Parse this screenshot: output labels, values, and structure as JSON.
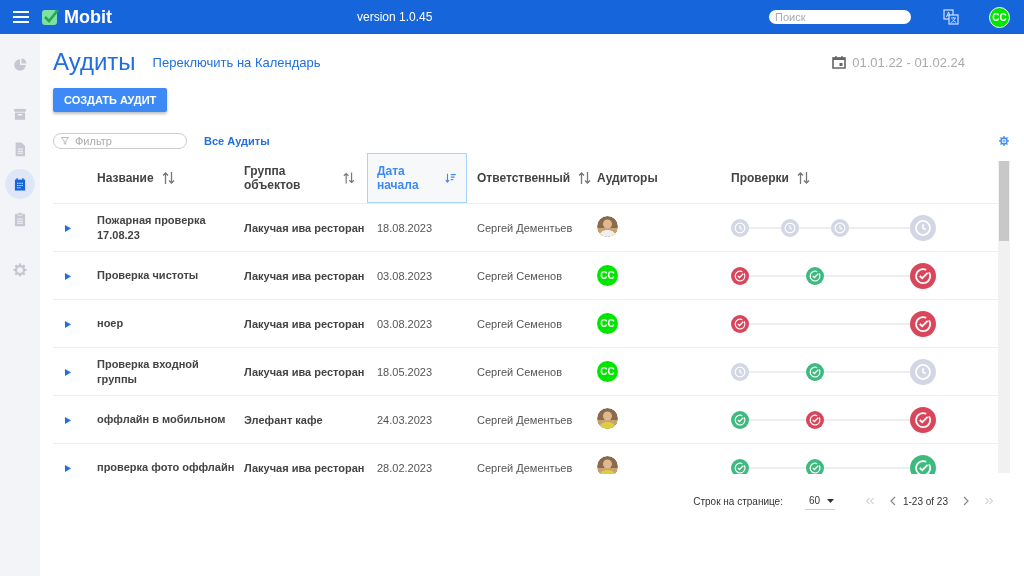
{
  "topbar": {
    "brand": "Mobit",
    "version": "version 1.0.45",
    "search": {
      "placeholder": "Поиск"
    },
    "user_initials": "CC"
  },
  "sidebar": {
    "items": [
      {
        "kind": "chart",
        "selected": false
      },
      {
        "kind": "archive",
        "selected": false
      },
      {
        "kind": "document",
        "selected": false
      },
      {
        "kind": "calendar",
        "selected": true
      },
      {
        "kind": "clipboard",
        "selected": false
      },
      {
        "kind": "settings",
        "selected": false
      }
    ]
  },
  "page": {
    "title": "Аудиты",
    "switch_link": "Переключить на Календарь",
    "date_range": "01.01.22 - 01.02.24",
    "create_button": "СОЗДАТЬ АУДИТ",
    "filter": {
      "placeholder": "Фильтр"
    },
    "all_link": "Все Аудиты"
  },
  "table": {
    "columns": [
      {
        "label": "Название",
        "sortable": true,
        "selected": false
      },
      {
        "label": "Группа объектов",
        "sortable": true,
        "selected": false
      },
      {
        "label": "Дата начала",
        "sortable": true,
        "selected": true
      },
      {
        "label": "Ответственный",
        "sortable": true,
        "selected": false
      },
      {
        "label": "Аудиторы",
        "sortable": false,
        "selected": false
      },
      {
        "label": "Проверки",
        "sortable": true,
        "selected": false
      }
    ],
    "rows": [
      {
        "name": "Пожарная проверка 17.08.23",
        "group": "Лакучая ива ресторан",
        "date": "18.08.2023",
        "owner": "Сергей Дементьев",
        "auditor": {
          "kind": "picture"
        },
        "checks": [
          {
            "kind": "pending"
          },
          {
            "kind": "pending"
          },
          {
            "kind": "pending"
          }
        ],
        "result": {
          "kind": "pending"
        }
      },
      {
        "name": "Проверка чистоты",
        "group": "Лакучая ива ресторан",
        "date": "03.08.2023",
        "owner": "Сергей Семенов",
        "auditor": {
          "kind": "initials",
          "initials": "CC"
        },
        "checks": [
          {
            "kind": "fail"
          },
          {
            "kind": "pass"
          }
        ],
        "result": {
          "kind": "fail"
        }
      },
      {
        "name": "ноер",
        "group": "Лакучая ива ресторан",
        "date": "03.08.2023",
        "owner": "Сергей Семенов",
        "auditor": {
          "kind": "initials",
          "initials": "CC"
        },
        "checks": [
          {
            "kind": "fail"
          }
        ],
        "result": {
          "kind": "fail"
        }
      },
      {
        "name": "Проверка входной группы",
        "group": "Лакучая ива ресторан",
        "date": "18.05.2023",
        "owner": "Сергей Семенов",
        "auditor": {
          "kind": "initials",
          "initials": "CC"
        },
        "checks": [
          {
            "kind": "pending"
          },
          {
            "kind": "pass"
          }
        ],
        "result": {
          "kind": "pending"
        }
      },
      {
        "name": "оффлайн в мобильном",
        "group": "Элефант кафе",
        "date": "24.03.2023",
        "owner": "Сергей Дементьев",
        "auditor": {
          "kind": "picture"
        },
        "checks": [
          {
            "kind": "pass"
          },
          {
            "kind": "fail"
          }
        ],
        "result": {
          "kind": "fail"
        }
      },
      {
        "name": "проверка фото оффлайн",
        "group": "Лакучая ива ресторан",
        "date": "28.02.2023",
        "owner": "Сергей Дементьев",
        "auditor": {
          "kind": "picture"
        },
        "checks": [
          {
            "kind": "pass"
          },
          {
            "kind": "pass"
          }
        ],
        "result": {
          "kind": "pass"
        }
      }
    ]
  },
  "pagination": {
    "rows_label": "Строк на странице:",
    "rows_per_page": "60",
    "range": "1-23 of 23"
  }
}
